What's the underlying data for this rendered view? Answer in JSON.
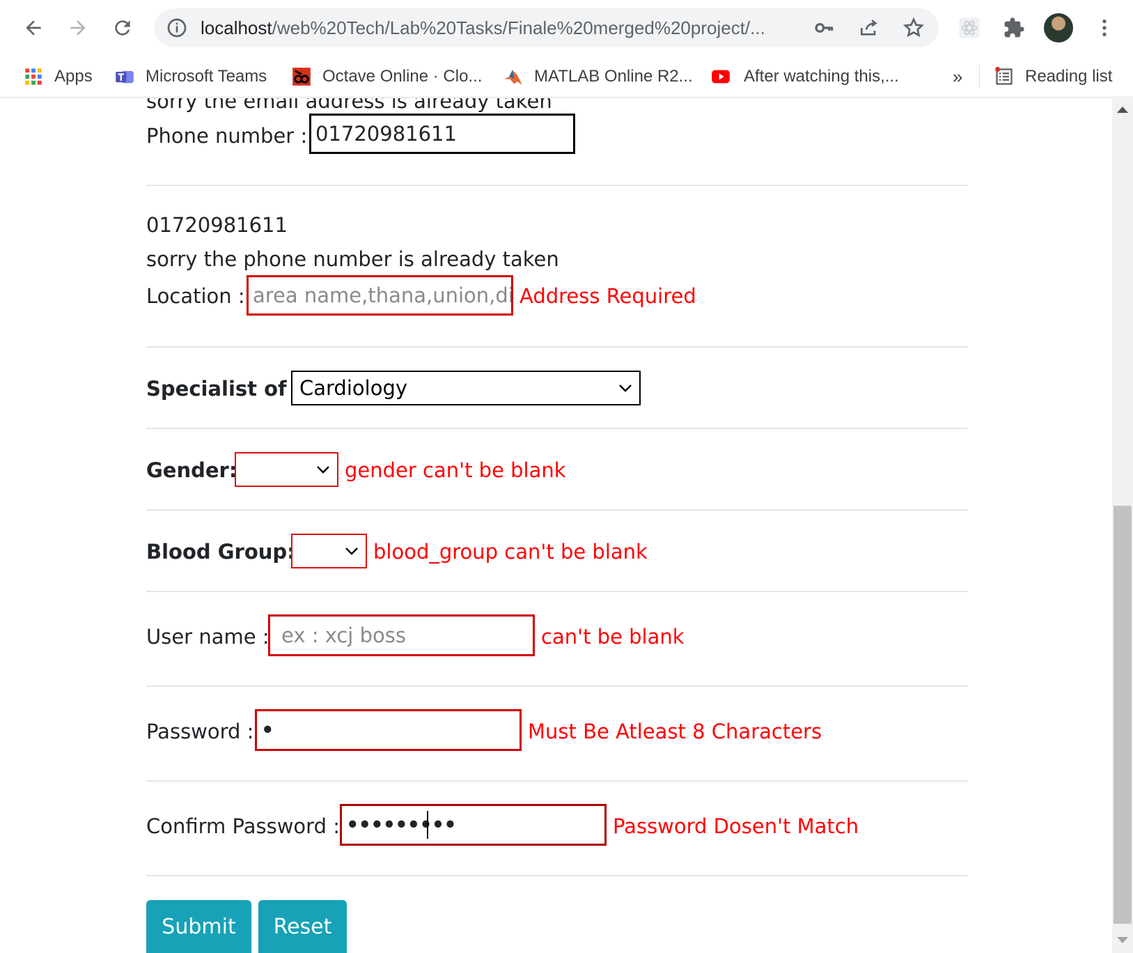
{
  "browser": {
    "url_host": "localhost",
    "url_path": "/web%20Tech/Lab%20Tasks/Finale%20merged%20project/...",
    "bookmarks": [
      {
        "label": "Apps",
        "icon": "apps-grid-icon"
      },
      {
        "label": "Microsoft Teams",
        "icon": "teams-icon"
      },
      {
        "label": "Octave Online · Clo...",
        "icon": "octave-icon"
      },
      {
        "label": "MATLAB Online R2...",
        "icon": "matlab-icon"
      },
      {
        "label": "After watching this,...",
        "icon": "youtube-icon"
      }
    ],
    "more_bookmarks": "»",
    "reading_list": "Reading list"
  },
  "form": {
    "partial_email_error": "sorry the email address is already taken",
    "phone": {
      "label": "Phone number :",
      "value": "01720981611",
      "echo": "01720981611",
      "error": "sorry the phone number is already taken"
    },
    "location": {
      "label": "Location :",
      "placeholder": "area name,thana,union,dis",
      "error": "Address Required"
    },
    "specialist": {
      "label": "Specialist of :",
      "selected": "Cardiology"
    },
    "gender": {
      "label": "Gender:",
      "selected": "",
      "error": "gender can't be blank"
    },
    "blood_group": {
      "label": "Blood Group:",
      "selected": "",
      "error": "blood_group can't be blank"
    },
    "username": {
      "label": "User name :",
      "placeholder": "ex : xcj boss",
      "error": "can't be blank"
    },
    "password": {
      "label": "Password :",
      "value": "•",
      "error": "Must Be Atleast 8 Characters"
    },
    "confirm_password": {
      "label": "Confirm Password :",
      "value": "•••••••••",
      "error": "Password Dosen't Match"
    },
    "submit_label": "Submit",
    "reset_label": "Reset"
  },
  "colors": {
    "error": "#ff0000",
    "button": "#17a2b8"
  }
}
